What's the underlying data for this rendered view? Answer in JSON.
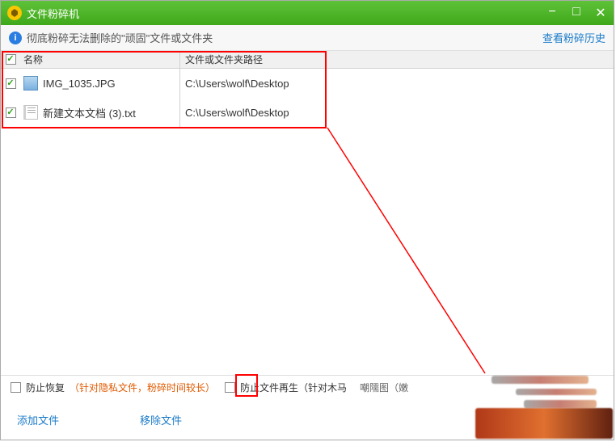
{
  "titlebar": {
    "title": "文件粉碎机"
  },
  "infobar": {
    "message": "彻底粉碎无法删除的\"顽固\"文件或文件夹",
    "history_link": "查看粉碎历史"
  },
  "table": {
    "col_name": "名称",
    "col_path": "文件或文件夹路径",
    "rows": [
      {
        "checked": true,
        "icon": "img",
        "name": "IMG_1035.JPG",
        "path": "C:\\Users\\wolf\\Desktop"
      },
      {
        "checked": true,
        "icon": "txt",
        "name": "新建文本文档 (3).txt",
        "path": "C:\\Users\\wolf\\Desktop"
      }
    ]
  },
  "options": {
    "prevent_recover_label": "防止恢复",
    "prevent_recover_hint": "（针对隐私文件，粉碎时间较长）",
    "prevent_regen_label": "防止文件再生（针对木马",
    "tail_garbled": "嘲隭图（嫩"
  },
  "actions": {
    "add_file": "添加文件",
    "remove_file": "移除文件"
  }
}
